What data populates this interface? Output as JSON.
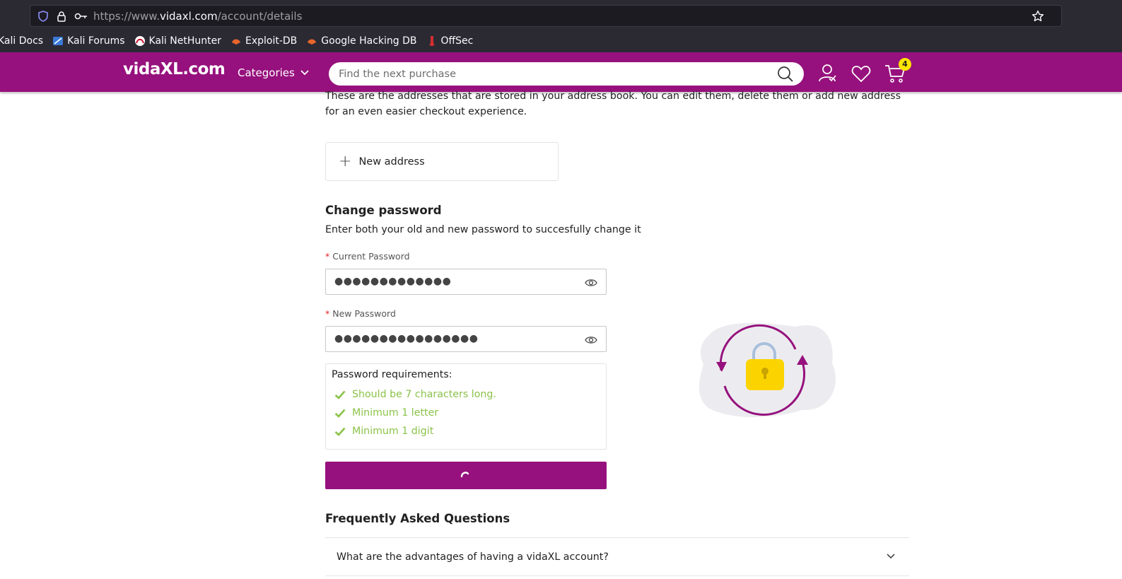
{
  "browser": {
    "url_prefix": "https://www.",
    "url_host": "vidaxl.com",
    "url_path": "/account/details",
    "bookmarks": [
      {
        "label": "Kali Docs",
        "icon": "kali-docs-icon"
      },
      {
        "label": "Kali Forums",
        "icon": "kali-forums-icon"
      },
      {
        "label": "Kali NetHunter",
        "icon": "kali-nethunter-icon"
      },
      {
        "label": "Exploit-DB",
        "icon": "exploit-db-icon"
      },
      {
        "label": "Google Hacking DB",
        "icon": "google-hacking-db-icon"
      },
      {
        "label": "OffSec",
        "icon": "offsec-icon"
      }
    ]
  },
  "header": {
    "logo": "vidaXL.com",
    "categories_label": "Categories",
    "search_placeholder": "Find the next purchase",
    "cart_count": "4",
    "brand_color": "#96117d"
  },
  "addresses": {
    "intro": "These are the addresses that are stored in your address book. You can edit them, delete them or add new address for an even easier checkout experience.",
    "new_address_label": "New address"
  },
  "change_password": {
    "title": "Change password",
    "subtitle": "Enter both your old and new password to succesfully change it",
    "current_label": "Current Password",
    "current_value": "●●●●●●●●●●●●●",
    "new_label": "New Password",
    "new_value": "●●●●●●●●●●●●●●●●",
    "requirements_title": "Password requirements:",
    "requirements": [
      "Should be 7 characters long.",
      "Minimum 1 letter",
      "Minimum 1 digit"
    ],
    "requirement_color": "#8bc34a"
  },
  "faq": {
    "title": "Frequently Asked Questions",
    "items": [
      "What are the advantages of having a vidaXL account?"
    ]
  }
}
